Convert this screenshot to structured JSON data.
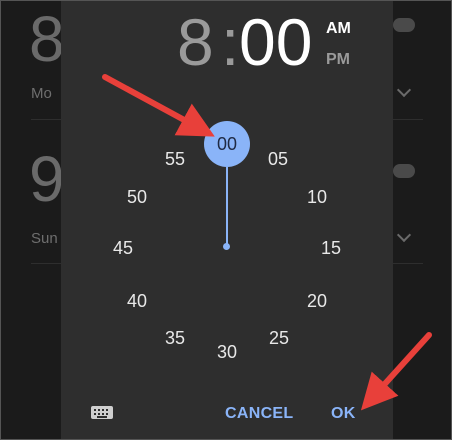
{
  "background_alarms": [
    {
      "time": "8",
      "days": "Mo"
    },
    {
      "time": "9",
      "days": "Sun"
    }
  ],
  "picker": {
    "hour": "8",
    "separator": ":",
    "minute": "00",
    "am_label": "AM",
    "pm_label": "PM",
    "selected_period": "AM",
    "selected_minute": "00",
    "minute_labels": [
      "00",
      "05",
      "10",
      "15",
      "20",
      "25",
      "30",
      "35",
      "40",
      "45",
      "50",
      "55"
    ]
  },
  "footer": {
    "keyboard_icon": "keyboard-icon",
    "cancel_label": "CANCEL",
    "ok_label": "OK"
  },
  "colors": {
    "accent": "#8ab4f8",
    "annotation_arrow": "#e8403a",
    "dialog_bg": "#2e2e2e"
  }
}
